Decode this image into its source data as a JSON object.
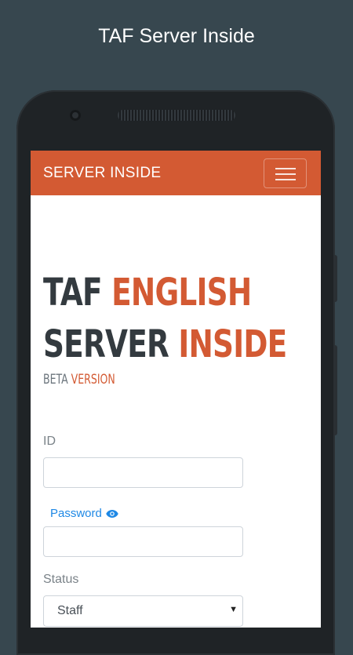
{
  "caption": "TAF Server Inside",
  "navbar": {
    "brand": "SERVER INSIDE"
  },
  "hero": {
    "line1_dark": "TAF",
    "line1_accent": "ENGLISH",
    "line2_dark": "SERVER",
    "line2_accent": "INSIDE",
    "beta_dark": "BETA",
    "beta_accent": "VERSION"
  },
  "form": {
    "id_label": "ID",
    "id_value": "",
    "password_label": "Password",
    "password_value": "",
    "status_label": "Status",
    "status_selected": "Staff"
  },
  "colors": {
    "accent": "#d35a33",
    "dark_text": "#333a3f",
    "link_blue": "#1e88e5",
    "background": "#37474f"
  },
  "icons": {
    "menu": "hamburger-icon",
    "password_toggle": "eye-icon",
    "select_arrow": "caret-down-icon"
  }
}
